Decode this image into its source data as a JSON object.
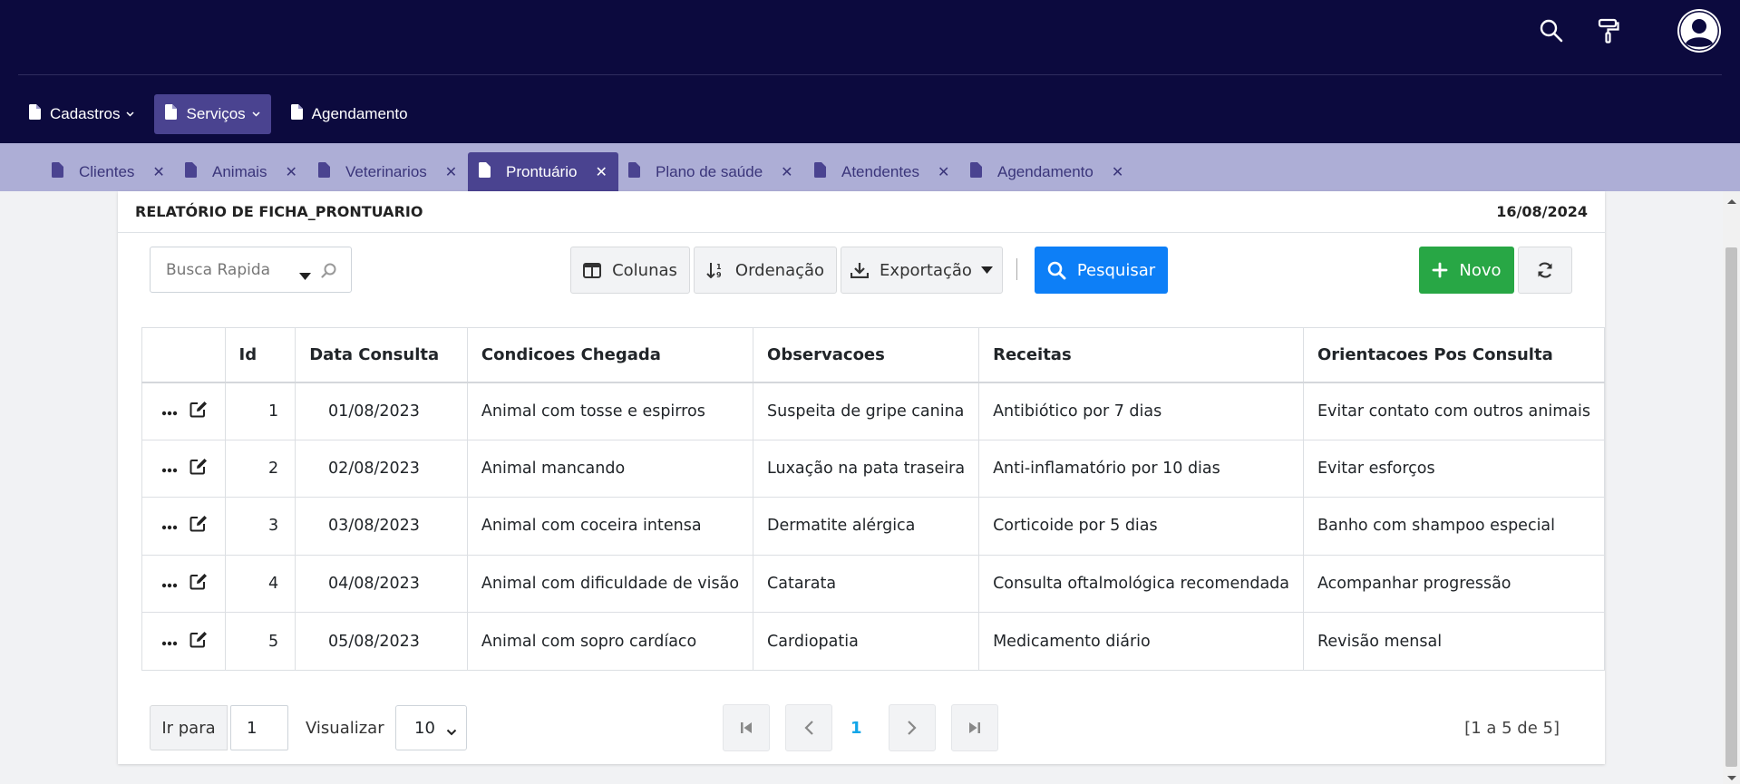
{
  "menu": {
    "items": [
      {
        "label": "Cadastros",
        "dropdown": true
      },
      {
        "label": "Serviços",
        "dropdown": true,
        "active": true
      },
      {
        "label": "Agendamento",
        "dropdown": false
      }
    ]
  },
  "tabs": [
    {
      "label": "Clientes"
    },
    {
      "label": "Animais"
    },
    {
      "label": "Veterinarios"
    },
    {
      "label": "Prontuário",
      "active": true
    },
    {
      "label": "Plano de saúde"
    },
    {
      "label": "Atendentes"
    },
    {
      "label": "Agendamento"
    }
  ],
  "report": {
    "title": "RELATÓRIO DE FICHA_PRONTUARIO",
    "date": "16/08/2024"
  },
  "toolbar": {
    "search_placeholder": "Busca Rapida",
    "columns_label": "Colunas",
    "sort_label": "Ordenação",
    "export_label": "Exportação",
    "search_button_label": "Pesquisar",
    "new_label": "Novo"
  },
  "table": {
    "headers": [
      "",
      "Id",
      "Data Consulta",
      "Condicoes Chegada",
      "Observacoes",
      "Receitas",
      "Orientacoes Pos Consulta"
    ],
    "rows": [
      [
        "1",
        "01/08/2023",
        "Animal com tosse e espirros",
        "Suspeita de gripe canina",
        "Antibiótico por 7 dias",
        "Evitar contato com outros animais"
      ],
      [
        "2",
        "02/08/2023",
        "Animal mancando",
        "Luxação na pata traseira",
        "Anti-inflamatório por 10 dias",
        "Evitar esforços"
      ],
      [
        "3",
        "03/08/2023",
        "Animal com coceira intensa",
        "Dermatite alérgica",
        "Corticoide por 5 dias",
        "Banho com shampoo especial"
      ],
      [
        "4",
        "04/08/2023",
        "Animal com dificuldade de visão",
        "Catarata",
        "Consulta oftalmológica recomendada",
        "Acompanhar progressão"
      ],
      [
        "5",
        "05/08/2023",
        "Animal com sopro cardíaco",
        "Cardiopatia",
        "Medicamento diário",
        "Revisão mensal"
      ]
    ]
  },
  "pagination": {
    "goto_label": "Ir para",
    "goto_value": "1",
    "view_label": "Visualizar",
    "page_size": "10",
    "current_page": "1",
    "range_text": "[1 a 5 de 5]"
  },
  "colors": {
    "header_bg": "#0c0a3e",
    "tabbar_bg": "#adaed6",
    "active_tab": "#4a4390",
    "primary": "#0d7ff7",
    "success": "#28a745"
  }
}
